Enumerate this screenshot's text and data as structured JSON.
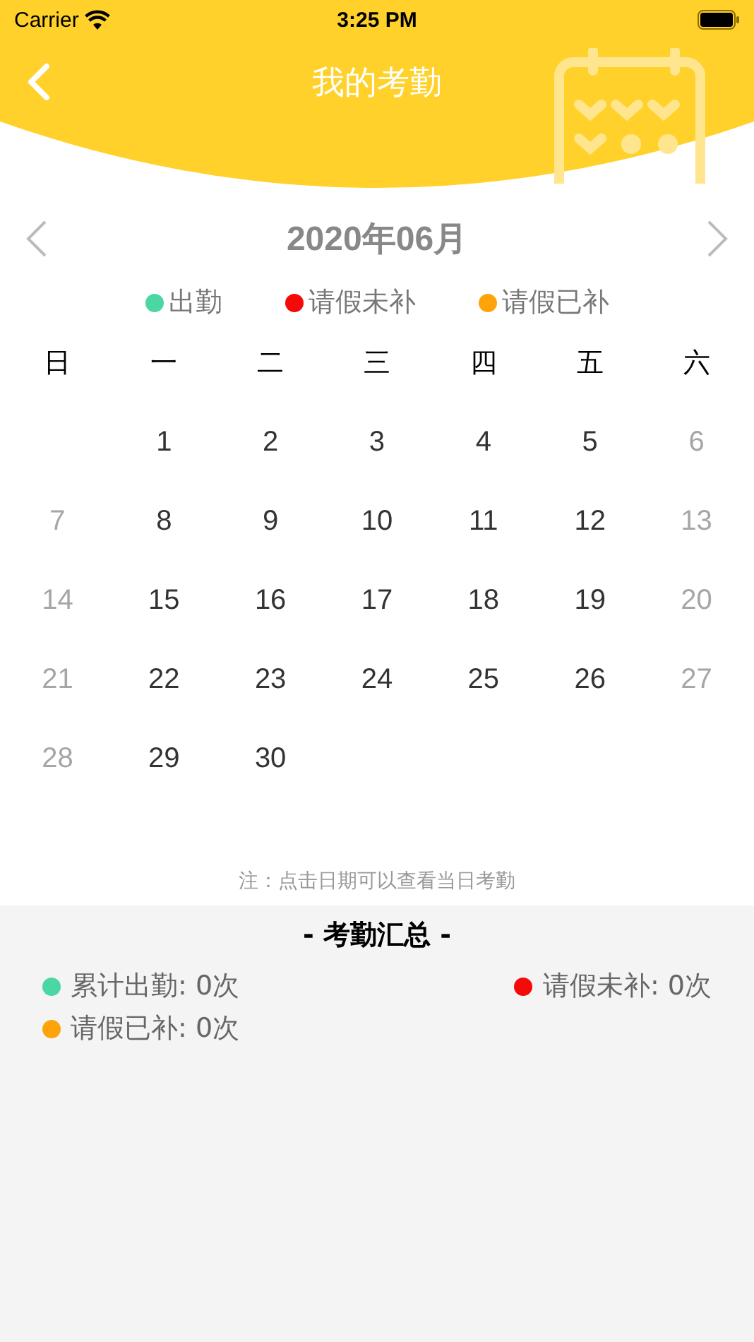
{
  "status_bar": {
    "carrier": "Carrier",
    "time": "3:25 PM"
  },
  "nav": {
    "title": "我的考勤"
  },
  "month": {
    "label": "2020年06月"
  },
  "legend": [
    {
      "label": "出勤",
      "color": "#4cd6a4"
    },
    {
      "label": "请假未补",
      "color": "#f50a0a"
    },
    {
      "label": "请假已补",
      "color": "#ffa30a"
    }
  ],
  "weekdays": [
    "日",
    "一",
    "二",
    "三",
    "四",
    "五",
    "六"
  ],
  "weeks": [
    [
      {
        "kind": "blank"
      },
      {
        "kind": "day",
        "day": "1",
        "weekend": false
      },
      {
        "kind": "day",
        "day": "2",
        "weekend": false
      },
      {
        "kind": "day",
        "day": "3",
        "weekend": false
      },
      {
        "kind": "day",
        "day": "4",
        "weekend": false
      },
      {
        "kind": "day",
        "day": "5",
        "weekend": false
      },
      {
        "kind": "day",
        "day": "6",
        "weekend": true
      }
    ],
    [
      {
        "kind": "day",
        "day": "7",
        "weekend": true
      },
      {
        "kind": "day",
        "day": "8",
        "weekend": false
      },
      {
        "kind": "day",
        "day": "9",
        "weekend": false
      },
      {
        "kind": "day",
        "day": "10",
        "weekend": false
      },
      {
        "kind": "day",
        "day": "11",
        "weekend": false
      },
      {
        "kind": "day",
        "day": "12",
        "weekend": false
      },
      {
        "kind": "day",
        "day": "13",
        "weekend": true
      }
    ],
    [
      {
        "kind": "day",
        "day": "14",
        "weekend": true
      },
      {
        "kind": "day",
        "day": "15",
        "weekend": false
      },
      {
        "kind": "day",
        "day": "16",
        "weekend": false
      },
      {
        "kind": "day",
        "day": "17",
        "weekend": false
      },
      {
        "kind": "day",
        "day": "18",
        "weekend": false
      },
      {
        "kind": "day",
        "day": "19",
        "weekend": false
      },
      {
        "kind": "day",
        "day": "20",
        "weekend": true
      }
    ],
    [
      {
        "kind": "day",
        "day": "21",
        "weekend": true
      },
      {
        "kind": "day",
        "day": "22",
        "weekend": false
      },
      {
        "kind": "day",
        "day": "23",
        "weekend": false
      },
      {
        "kind": "day",
        "day": "24",
        "weekend": false
      },
      {
        "kind": "day",
        "day": "25",
        "weekend": false
      },
      {
        "kind": "day",
        "day": "26",
        "weekend": false
      },
      {
        "kind": "day",
        "day": "27",
        "weekend": true
      }
    ],
    [
      {
        "kind": "day",
        "day": "28",
        "weekend": true
      },
      {
        "kind": "day",
        "day": "29",
        "weekend": false
      },
      {
        "kind": "day",
        "day": "30",
        "weekend": false
      }
    ]
  ],
  "note": "注：点击日期可以查看当日考勤",
  "summary": {
    "title": "- 考勤汇总 -",
    "items": [
      {
        "label": "累计出勤: 0次",
        "color": "#4cd6a4"
      },
      {
        "label": "请假未补: 0次",
        "color": "#f50a0a"
      },
      {
        "label": "请假已补: 0次",
        "color": "#ffa30a"
      }
    ]
  }
}
